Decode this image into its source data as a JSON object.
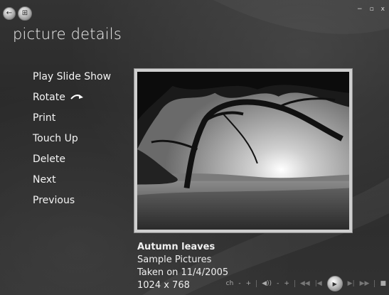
{
  "page": {
    "title": "picture details"
  },
  "window": {
    "minimize": "−",
    "restore": "▫",
    "close": "x"
  },
  "nav": {
    "back": "←",
    "start": "⊞"
  },
  "menu": {
    "items": [
      {
        "label": "Play Slide Show"
      },
      {
        "label": "Rotate"
      },
      {
        "label": "Print"
      },
      {
        "label": "Touch Up"
      },
      {
        "label": "Delete"
      },
      {
        "label": "Next"
      },
      {
        "label": "Previous"
      }
    ]
  },
  "picture": {
    "name": "Autumn leaves",
    "folder": "Sample Pictures",
    "taken": "Taken on 11/4/2005",
    "dimensions": "1024 x 768"
  },
  "transport": {
    "channel_label": "ch",
    "channel_down": "-",
    "channel_up": "+",
    "volume_icon": "◀))",
    "volume_down": "-",
    "volume_up": "+",
    "rewind": "◀◀",
    "previous": "|◀",
    "next": "▶|",
    "fast_forward": "▶▶",
    "stop": "■",
    "play": "▶"
  }
}
